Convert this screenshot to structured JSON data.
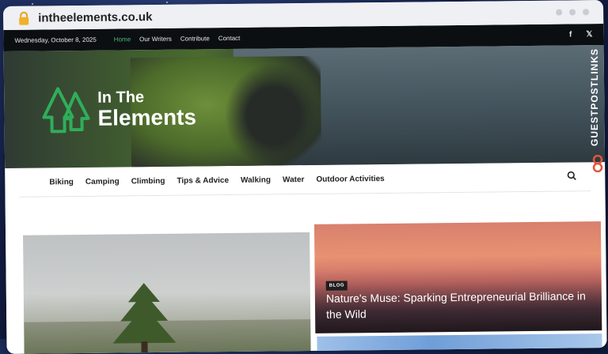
{
  "browser": {
    "url": "intheelements.co.uk"
  },
  "topbar": {
    "date": "Wednesday, October 8, 2025",
    "nav": [
      "Home",
      "Our Writers",
      "Contribute",
      "Contact"
    ],
    "social": [
      "f",
      "𝕏"
    ]
  },
  "brand": {
    "line1": "In The",
    "line2": "Elements",
    "side_brand": "GUESTPOSTLINKS"
  },
  "main_nav": [
    "Biking",
    "Camping",
    "Climbing",
    "Tips & Advice",
    "Walking",
    "Water",
    "Outdoor Activities"
  ],
  "featured": {
    "badge": "BLOG",
    "headline": "Nature's Muse: Sparking Entrepreneurial Brilliance in the Wild"
  },
  "colors": {
    "accent": "#49b86b",
    "logo_green": "#2fae5a"
  }
}
